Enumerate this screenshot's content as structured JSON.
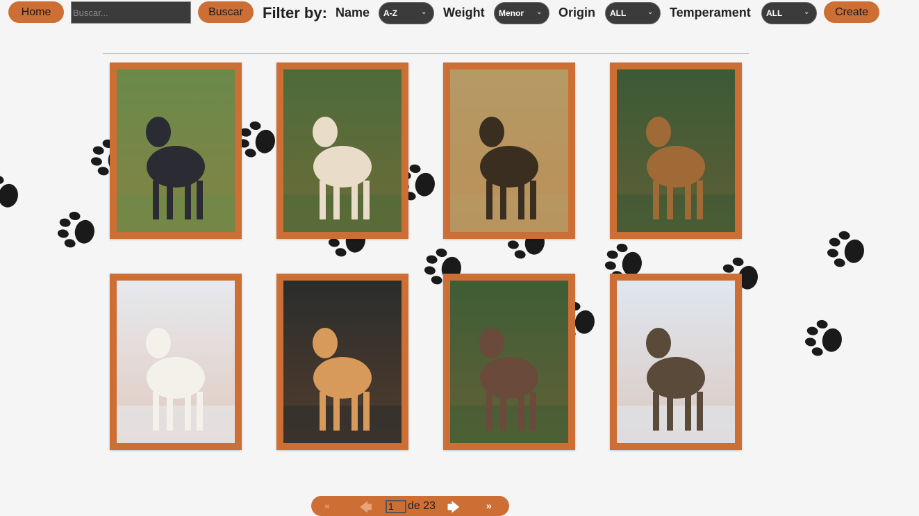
{
  "toolbar": {
    "home_label": "Home",
    "search_placeholder": "Buscar...",
    "search_button_label": "Buscar",
    "filter_title": "Filter by:",
    "name_label": "Name",
    "name_value": "A-Z",
    "weight_label": "Weight",
    "weight_value": "Menor",
    "origin_label": "Origin",
    "origin_value": "ALL",
    "temperament_label": "Temperament",
    "temperament_value": "ALL",
    "create_label": "Create"
  },
  "cards": [
    {
      "subject": "black-shaggy-dog",
      "colors": [
        "#6a8a4a",
        "#2b2b33"
      ]
    },
    {
      "subject": "afghan-hound",
      "colors": [
        "#4d6b3a",
        "#e9dcc8"
      ]
    },
    {
      "subject": "african-wild-dog",
      "colors": [
        "#b59a64",
        "#3a2e20"
      ]
    },
    {
      "subject": "airedale-terrier",
      "colors": [
        "#3b5a36",
        "#a06a36"
      ]
    },
    {
      "subject": "white-dog-in-snow",
      "colors": [
        "#e6e9ee",
        "#f4f1ea"
      ]
    },
    {
      "subject": "akita",
      "colors": [
        "#2a2d2c",
        "#d89a5a"
      ]
    },
    {
      "subject": "bulldog",
      "colors": [
        "#3f5d36",
        "#6a4a3a"
      ]
    },
    {
      "subject": "husky-in-snow",
      "colors": [
        "#dfe7f0",
        "#5a4a3a"
      ]
    }
  ],
  "pagination": {
    "first_icon": "double-left-icon",
    "prev_icon": "arrow-left-icon",
    "current_page": "1",
    "of_text": "de 23",
    "next_icon": "arrow-right-icon",
    "last_icon": "double-right-icon"
  },
  "colors": {
    "accent": "#cd6e34",
    "background": "#f5f5f5",
    "select_bg": "#3b3b3b"
  }
}
